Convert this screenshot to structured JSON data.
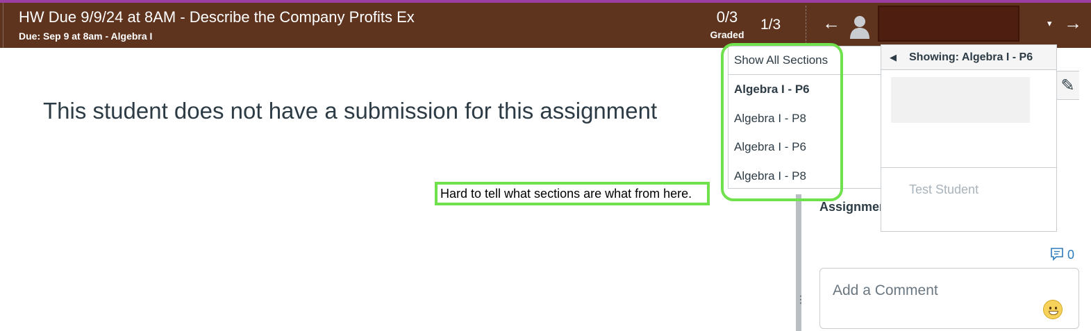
{
  "header": {
    "title": "HW Due 9/9/24 at 8AM - Describe the Company Profits Ex",
    "subtitle": "Due: Sep 9 at 8am - Algebra I",
    "score_value": "0/3",
    "score_label": "Graded",
    "student_count": "1/3",
    "prev_icon": "←",
    "next_icon": "→",
    "caret_icon": "▾"
  },
  "main": {
    "no_submission_text": "This student does not have a submission for this assignment"
  },
  "annotation": {
    "text": "Hard to tell what sections are what from here."
  },
  "section_menu": {
    "items": [
      {
        "label": "Show All Sections"
      },
      {
        "label": "Algebra I - P6",
        "selected": true
      },
      {
        "label": "Algebra I - P8"
      },
      {
        "label": "Algebra I - P6"
      },
      {
        "label": "Algebra I - P8"
      }
    ]
  },
  "student_menu": {
    "back_icon": "◀",
    "showing_label": "Showing: Algebra I - P6",
    "test_student": "Test Student"
  },
  "sidebar": {
    "assignment_label": "Assignment",
    "edit_icon": "✎",
    "comment_count": "0"
  },
  "comment": {
    "placeholder": "Add a Comment"
  },
  "colors": {
    "header_bg": "#5e341f",
    "highlight": "#6ee14d",
    "accent_link": "#2c7bbd"
  }
}
